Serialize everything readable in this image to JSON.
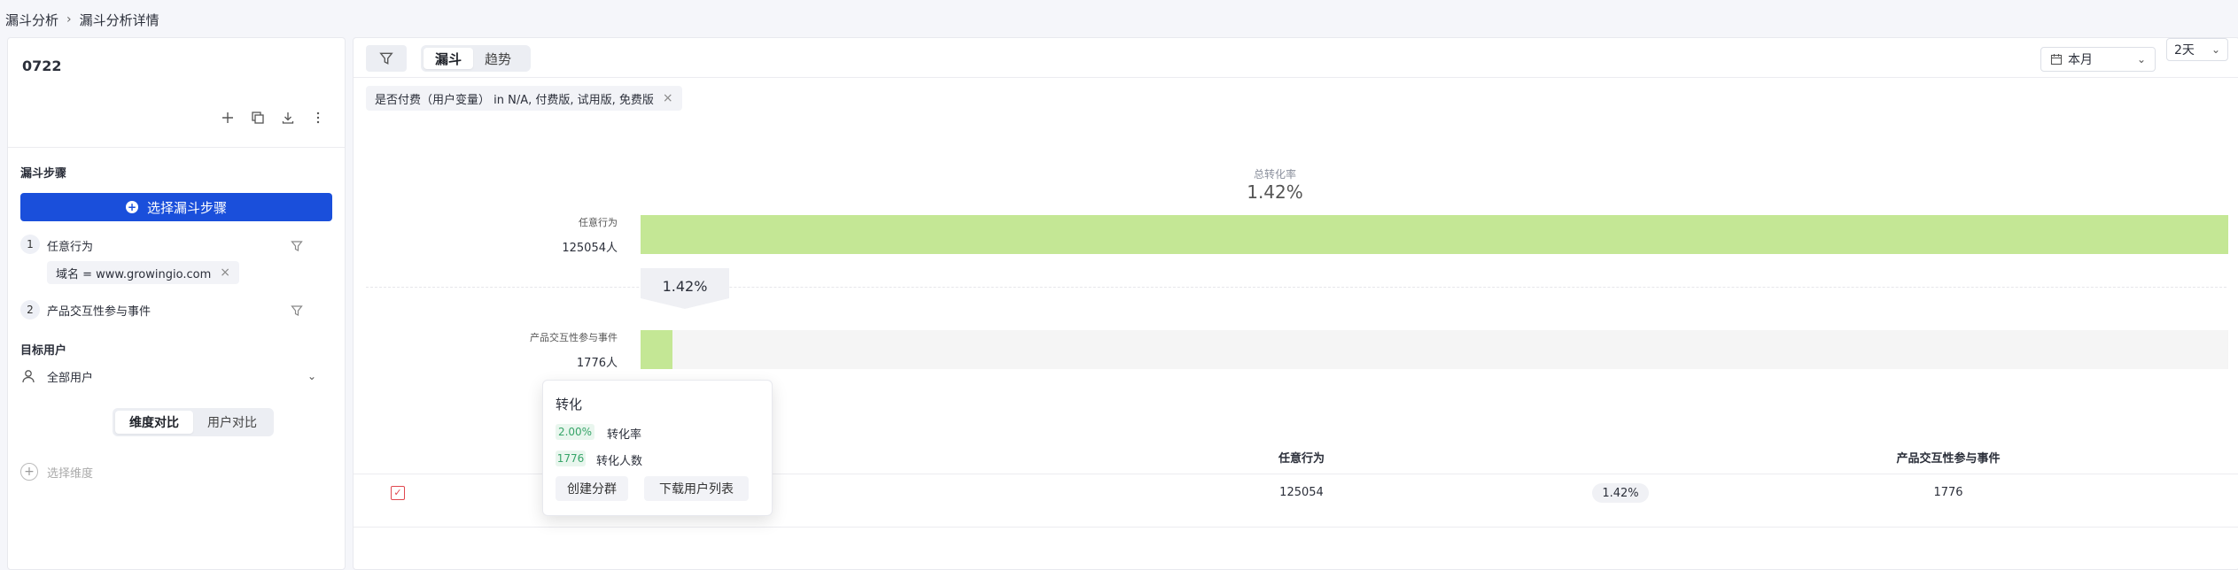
{
  "breadcrumb": {
    "root": "漏斗分析",
    "current": "漏斗分析详情"
  },
  "sidebar": {
    "title": "0722",
    "steps_heading": "漏斗步骤",
    "select_steps_button": "选择漏斗步骤",
    "steps": [
      {
        "num": "1",
        "label": "任意行为",
        "filter": "域名 = www.growingio.com"
      },
      {
        "num": "2",
        "label": "产品交互性参与事件"
      }
    ],
    "target_heading": "目标用户",
    "target_value": "全部用户",
    "compare_tabs": [
      "维度对比",
      "用户对比"
    ],
    "select_dimension": "选择维度"
  },
  "toolbar": {
    "tabs": [
      "漏斗",
      "趋势"
    ],
    "date_value": "本月",
    "window_value": "2天"
  },
  "filter_chip": "是否付费（用户变量） in N/A, 付费版, 试用版, 免费版",
  "funnel": {
    "overall_label": "总转化率",
    "overall_rate": "1.42%",
    "steps": [
      {
        "label": "任意行为",
        "count": "125054人",
        "fraction": 1.0
      },
      {
        "label": "产品交互性参与事件",
        "count": "1776人",
        "fraction": 0.0142
      }
    ],
    "step_rate": "1.42%"
  },
  "tooltip": {
    "title": "转化",
    "rate_value": "2.00%",
    "rate_label": "转化率",
    "count_value": "1776",
    "count_label": "转化人数",
    "create_segment": "创建分群",
    "download_users": "下载用户列表"
  },
  "table": {
    "headers": [
      "任意行为",
      "产品交互性参与事件"
    ],
    "row": {
      "checkbox": "✓",
      "step1": "125054",
      "rate": "1.42%",
      "step2": "1776"
    }
  },
  "colors": {
    "accent": "#1a4fdb",
    "bar": "#c4e795",
    "checkbox": "#e0484f",
    "rate_green": "#37a569"
  }
}
